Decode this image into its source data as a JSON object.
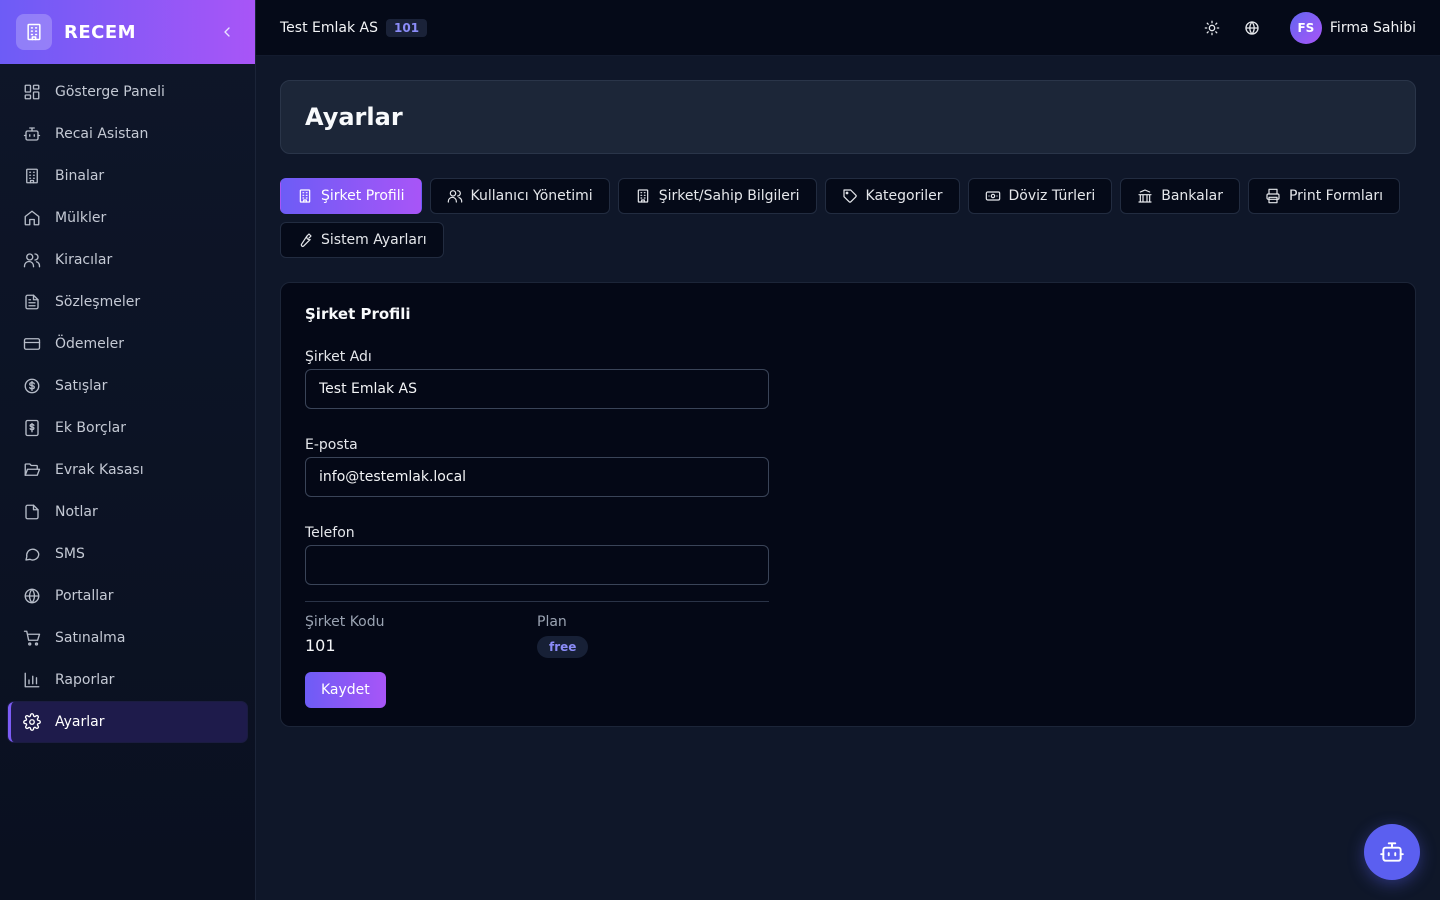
{
  "brand": {
    "name": "RECEM",
    "logo_icon": "building-icon"
  },
  "sidebar": {
    "items": [
      {
        "label": "Gösterge Paneli",
        "icon": "dashboard-icon",
        "active": false
      },
      {
        "label": "Recai Asistan",
        "icon": "bot-icon",
        "active": false
      },
      {
        "label": "Binalar",
        "icon": "building-icon",
        "active": false
      },
      {
        "label": "Mülkler",
        "icon": "home-icon",
        "active": false
      },
      {
        "label": "Kiracılar",
        "icon": "users-icon",
        "active": false
      },
      {
        "label": "Sözleşmeler",
        "icon": "file-text-icon",
        "active": false
      },
      {
        "label": "Ödemeler",
        "icon": "credit-card-icon",
        "active": false
      },
      {
        "label": "Satışlar",
        "icon": "dollar-circle-icon",
        "active": false
      },
      {
        "label": "Ek Borçlar",
        "icon": "receipt-icon",
        "active": false
      },
      {
        "label": "Evrak Kasası",
        "icon": "folder-open-icon",
        "active": false
      },
      {
        "label": "Notlar",
        "icon": "note-icon",
        "active": false
      },
      {
        "label": "SMS",
        "icon": "message-icon",
        "active": false
      },
      {
        "label": "Portallar",
        "icon": "globe-icon",
        "active": false
      },
      {
        "label": "Satınalma",
        "icon": "cart-icon",
        "active": false
      },
      {
        "label": "Raporlar",
        "icon": "bar-chart-icon",
        "active": false
      },
      {
        "label": "Ayarlar",
        "icon": "gear-icon",
        "active": true
      }
    ]
  },
  "topbar": {
    "company_name": "Test Emlak AS",
    "company_code": "101",
    "user_initials": "FS",
    "user_name": "Firma Sahibi"
  },
  "page": {
    "title": "Ayarlar"
  },
  "tabs": [
    {
      "label": "Şirket Profili",
      "icon": "building-icon",
      "active": true
    },
    {
      "label": "Kullanıcı Yönetimi",
      "icon": "users-icon",
      "active": false
    },
    {
      "label": "Şirket/Sahip Bilgileri",
      "icon": "building-icon",
      "active": false
    },
    {
      "label": "Kategoriler",
      "icon": "tag-icon",
      "active": false
    },
    {
      "label": "Döviz Türleri",
      "icon": "banknote-icon",
      "active": false
    },
    {
      "label": "Bankalar",
      "icon": "bank-icon",
      "active": false
    },
    {
      "label": "Print Formları",
      "icon": "printer-icon",
      "active": false
    },
    {
      "label": "Sistem Ayarları",
      "icon": "wrench-icon",
      "active": false
    }
  ],
  "form": {
    "section_title": "Şirket Profili",
    "company_name_label": "Şirket Adı",
    "company_name_value": "Test Emlak AS",
    "email_label": "E-posta",
    "email_value": "info@testemlak.local",
    "phone_label": "Telefon",
    "phone_value": "",
    "code_label": "Şirket Kodu",
    "code_value": "101",
    "plan_label": "Plan",
    "plan_value": "free",
    "save_label": "Kaydet"
  },
  "colors": {
    "accent_start": "#6d5cf6",
    "accent_end": "#a855f7",
    "background": "#0f1729",
    "fab": "#5b5ff0"
  }
}
